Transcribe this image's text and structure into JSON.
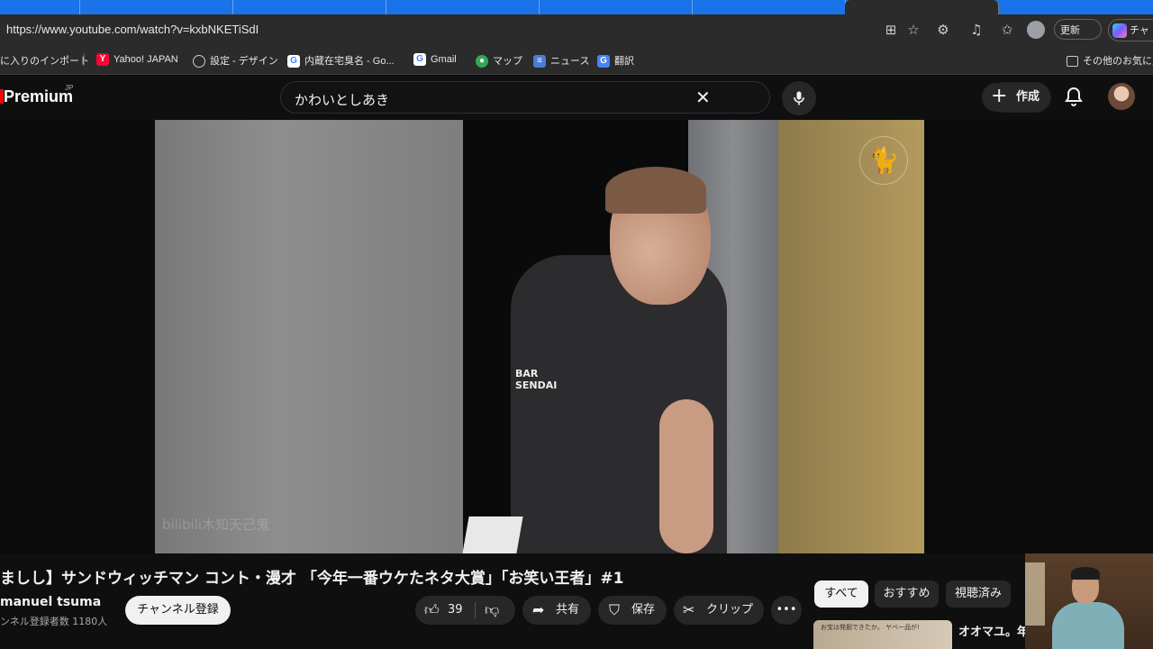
{
  "browser": {
    "url": "https://www.youtube.com/watch?v=kxbNKETiSdI",
    "update_label": "更新",
    "more_label": "•••",
    "copilot_label": "チャ",
    "bookmarks": [
      {
        "label": "に入りのインポート",
        "icon": "none"
      },
      {
        "label": "Yahoo! JAPAN",
        "icon": "yahoo-icon"
      },
      {
        "label": "設定 - デザイン",
        "icon": "globe-icon"
      },
      {
        "label": "内蔵在宅臭名 - Go...",
        "icon": "google-icon"
      },
      {
        "label": "Gmail",
        "icon": "google-icon"
      },
      {
        "label": "マップ",
        "icon": "maps-icon"
      },
      {
        "label": "ニュース",
        "icon": "news-icon"
      },
      {
        "label": "翻訳",
        "icon": "translate-icon"
      }
    ],
    "other_favorites_label": "その他のお気に入"
  },
  "youtube": {
    "logo_text": "Premium",
    "region": "JP",
    "search_query": "かわいとしあき",
    "create_label": "作成"
  },
  "video": {
    "watermark": "bilibili木知天己鬼",
    "shirt_text": "BAR SENDAI"
  },
  "meta": {
    "title": "ましし】サンドウィッチマン コント・漫才 「今年一番ウケたネタ大賞」「お笑い王者」#1",
    "channel_name": "manuel tsuma",
    "subscribers": "ンネル登録者数 1180人",
    "subscribe_label": "チャンネル登録",
    "like_count": "39",
    "share_label": "共有",
    "save_label": "保存",
    "clip_label": "クリップ",
    "more_label": "•••"
  },
  "chips": [
    "すべて",
    "おすすめ",
    "視聴済み"
  ],
  "recommendation": {
    "title": "オオマユ。年",
    "thumb_text": "お宝は発掘できたか。 ヤベー品が!"
  }
}
